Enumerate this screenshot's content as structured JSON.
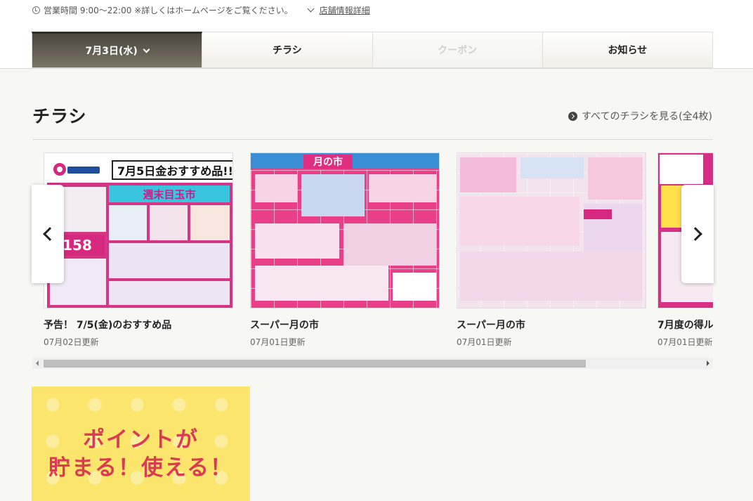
{
  "header": {
    "hours": "営業時間 9:00〜22:00 ※詳しくはホームページをご覧ください。",
    "store_info_link": "店舗情報詳細"
  },
  "tabs": [
    {
      "label": "7月3日(水)",
      "state": "active"
    },
    {
      "label": "チラシ",
      "state": "normal"
    },
    {
      "label": "クーポン",
      "state": "disabled"
    },
    {
      "label": "お知らせ",
      "state": "normal"
    }
  ],
  "section": {
    "title": "チラシ",
    "see_all": "すべてのチラシを見る(全4枚)"
  },
  "flyers": [
    {
      "title": "予告！ 7/5(金)のおすすめ品",
      "date": "07月02日更新"
    },
    {
      "title": "スーパー月の市",
      "date": "07月01日更新"
    },
    {
      "title": "スーパー月の市",
      "date": "07月01日更新"
    },
    {
      "title": "7月度の得ル",
      "date": "07月01日更新"
    }
  ],
  "flyer_art": {
    "a_header": "7月5日金おすすめ品!!",
    "a_banner": "週末目玉市",
    "a_price": "158",
    "b_headline": "月の市"
  },
  "promo": {
    "line1": "ポイントが",
    "line2": "貯まる！使える！"
  },
  "colors": {
    "tab_active": "#5e594d",
    "flyer_pink": "#d43584",
    "promo_bg": "#fbe56c",
    "promo_text": "#d93b52"
  }
}
